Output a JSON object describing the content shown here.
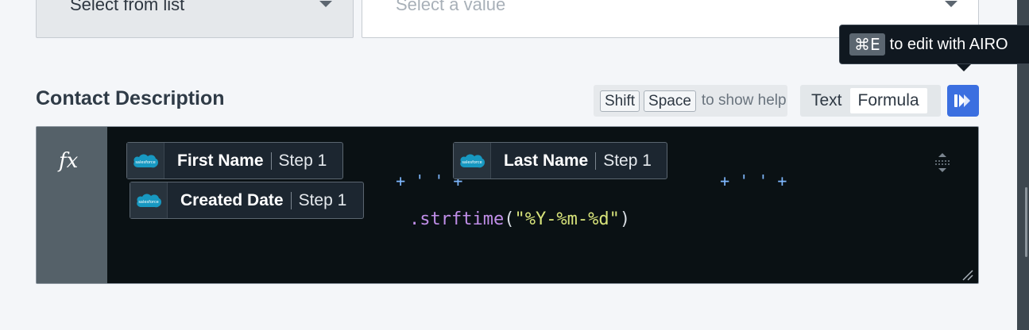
{
  "top_fields": {
    "left_select_value": "Select from list",
    "right_select_placeholder": "Select a value"
  },
  "tooltip": {
    "shortcut": "⌘E",
    "text": "to edit with AIRO"
  },
  "field": {
    "label": "Contact Description",
    "help_keys": [
      "Shift",
      "Space"
    ],
    "help_text": "to show help",
    "modes": [
      "Text",
      "Formula"
    ],
    "active_mode": "Formula"
  },
  "editor": {
    "gutter_symbol": "fx",
    "chips": [
      {
        "name": "First Name",
        "step": "Step 1",
        "logo": "salesforce-logo-icon"
      },
      {
        "name": "Last Name",
        "step": "Step 1",
        "logo": "salesforce-logo-icon"
      },
      {
        "name": "Created Date",
        "step": "Step 1",
        "logo": "salesforce-logo-icon"
      }
    ],
    "separator_op": "+ ' ' +",
    "method": ".strftime",
    "open_paren": "(",
    "format_string": "\"%Y-%m-%d\"",
    "close_paren": ")"
  },
  "colors": {
    "accent": "#3b6fe0",
    "editor_bg": "#0a1114",
    "gutter_bg": "#556169",
    "salesforce_blue": "#1798c1"
  }
}
